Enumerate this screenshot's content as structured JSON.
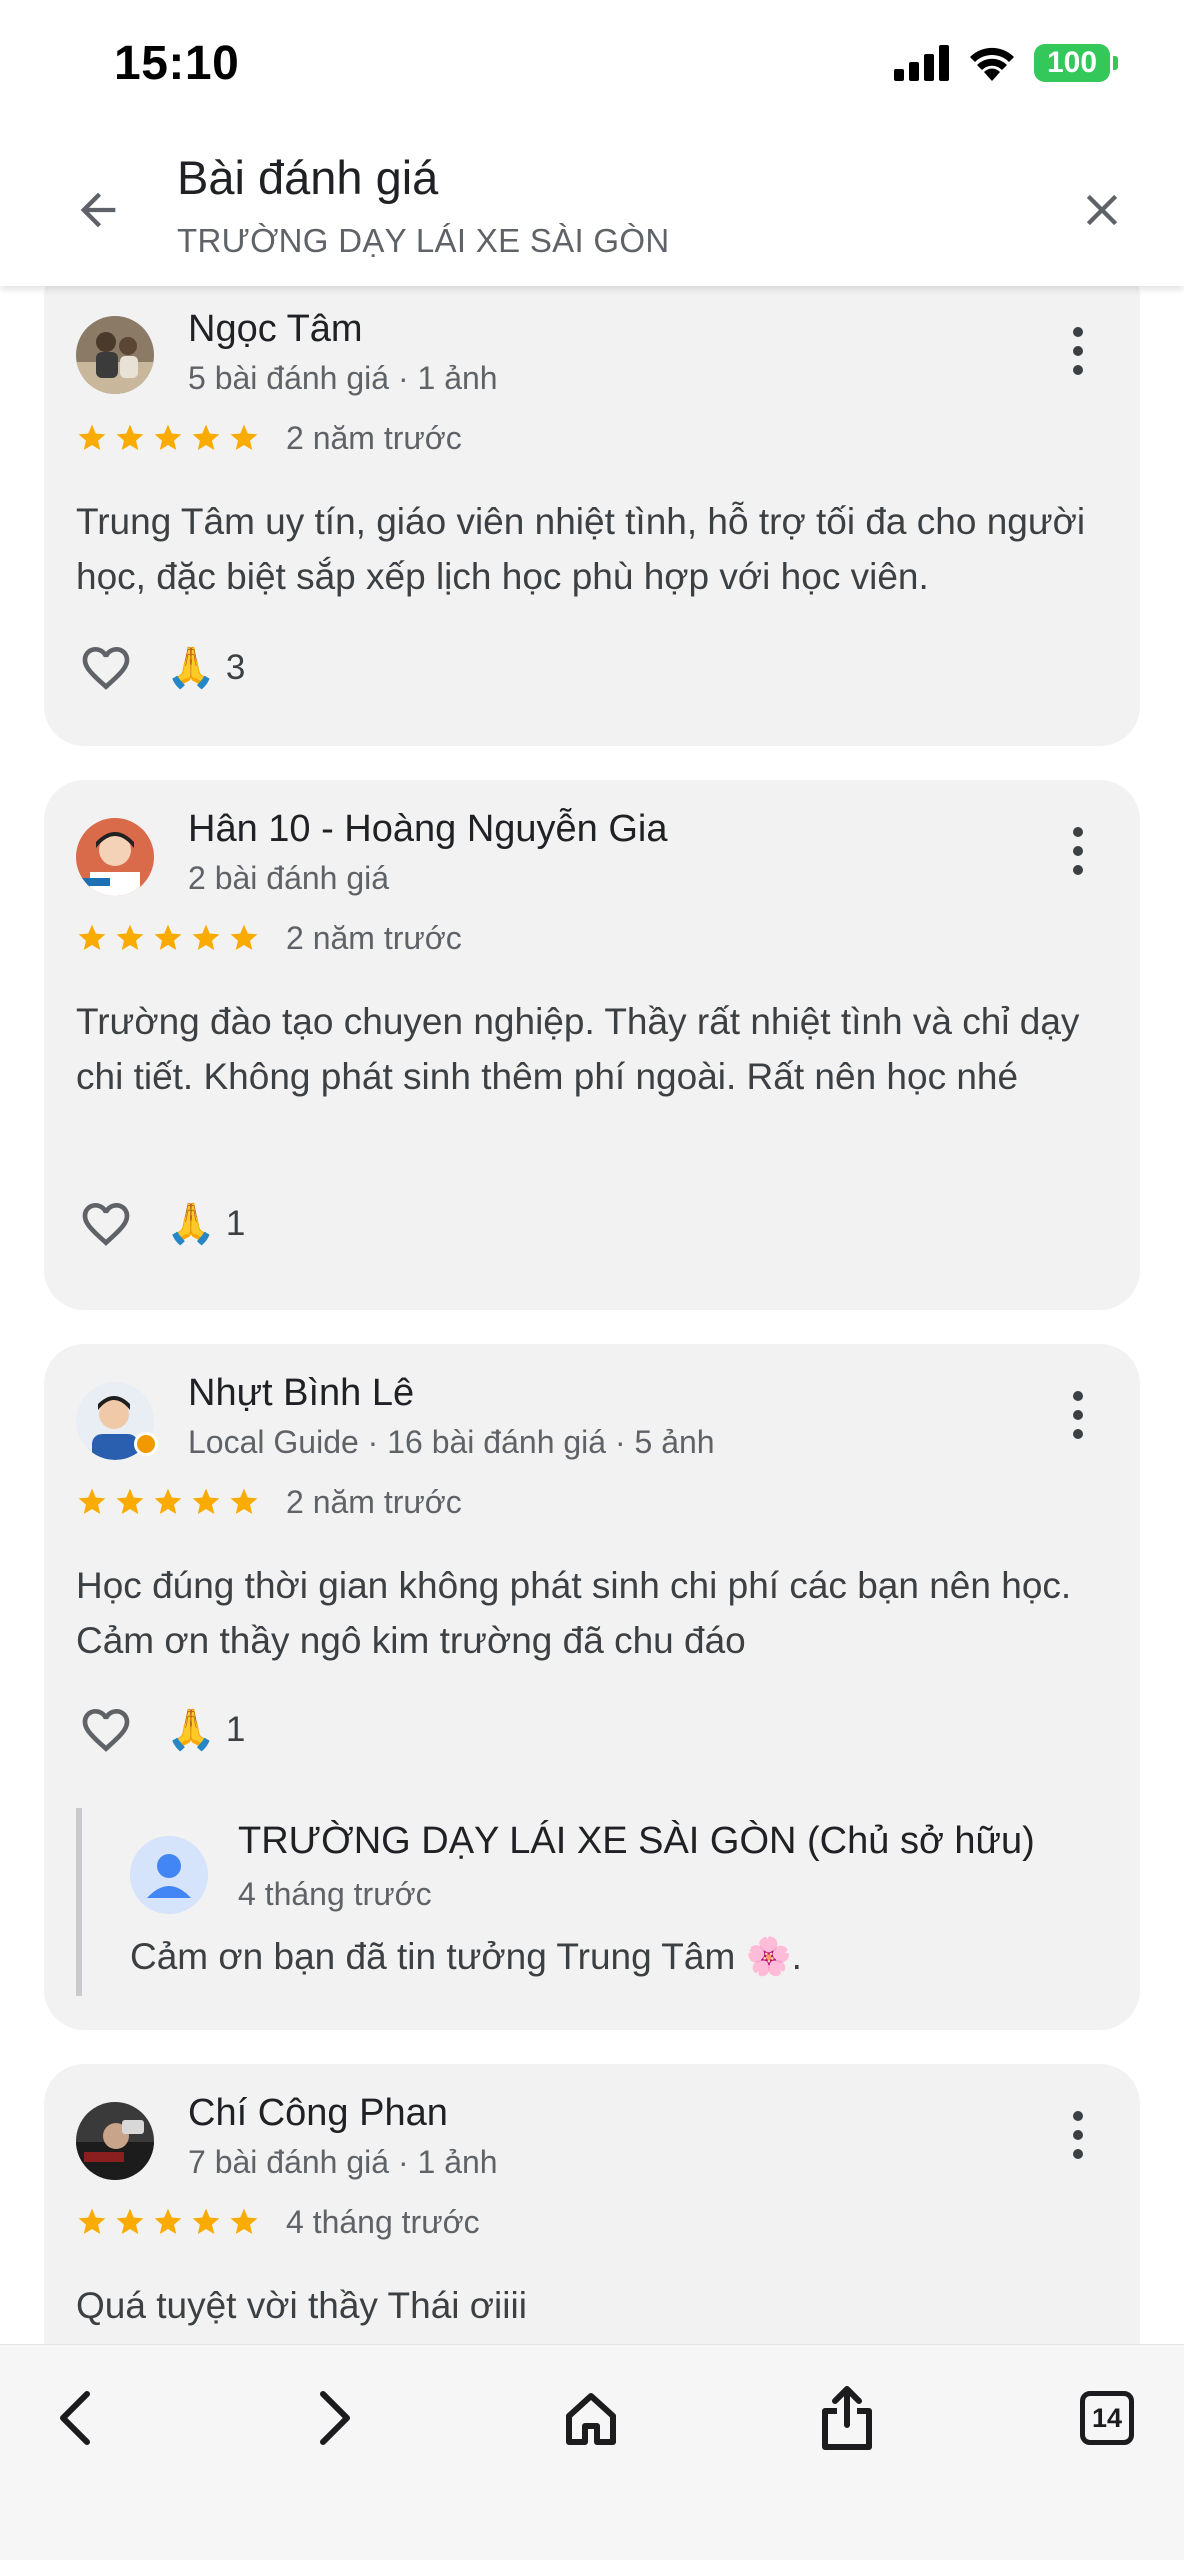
{
  "status_bar": {
    "time": "15:10",
    "battery": "100"
  },
  "header": {
    "title": "Bài đánh giá",
    "subtitle": "TRƯỜNG DẠY LÁI XE SÀI GÒN"
  },
  "colors": {
    "star": "#f9ab00",
    "card_background": "#f2f2f2",
    "battery": "#34c759",
    "owner_avatar": "#4285f4"
  },
  "reviews": [
    {
      "name": "Ngọc Tâm",
      "meta": "5 bài đánh giá · 1 ảnh",
      "rating": 5,
      "time": "2 năm trước",
      "text": "Trung Tâm uy tín, giáo viên nhiệt tình, hỗ trợ tối đa cho người học, đặc biệt sắp xếp lịch học phù hợp với học viên.",
      "reaction_count": "3"
    },
    {
      "name": "Hân 10 - Hoàng Nguyễn Gia",
      "meta": "2 bài đánh giá",
      "rating": 5,
      "time": "2 năm trước",
      "text": "Trường đào tạo chuyen nghiệp. Thầy rất nhiệt tình và chỉ dạy chi tiết. Không phát sinh thêm phí ngoài. Rất nên học nhé",
      "reaction_count": "1"
    },
    {
      "name": "Nhựt Bình Lê",
      "meta": "Local Guide · 16 bài đánh giá · 5 ảnh",
      "rating": 5,
      "time": "2 năm trước",
      "text": "Học đúng thời gian không phát sinh chi phí các bạn nên học. Cảm ơn thầy ngô kim trường đã chu đáo",
      "reaction_count": "1",
      "owner_reply": {
        "name": "TRƯỜNG DẠY LÁI XE SÀI GÒN (Chủ sở hữu)",
        "time": "4 tháng trước",
        "text": "Cảm ơn bạn đã tin tưởng Trung Tâm 🌸."
      }
    },
    {
      "name": "Chí Công Phan",
      "meta": "7 bài đánh giá · 1 ảnh",
      "rating": 5,
      "time": "4 tháng trước",
      "text": "Quá tuyệt vời thầy Thái ơiiii"
    }
  ],
  "reaction_emoji": "🙏",
  "toolbar": {
    "tabs_count": "14"
  },
  "icons": [
    "back-arrow-icon",
    "close-icon",
    "more-vert-icon",
    "star-icon",
    "heart-outline-icon",
    "person-icon",
    "chevron-left-icon",
    "chevron-right-icon",
    "home-icon",
    "share-icon",
    "tabs-icon",
    "signal-icon",
    "wifi-icon",
    "battery-icon"
  ]
}
